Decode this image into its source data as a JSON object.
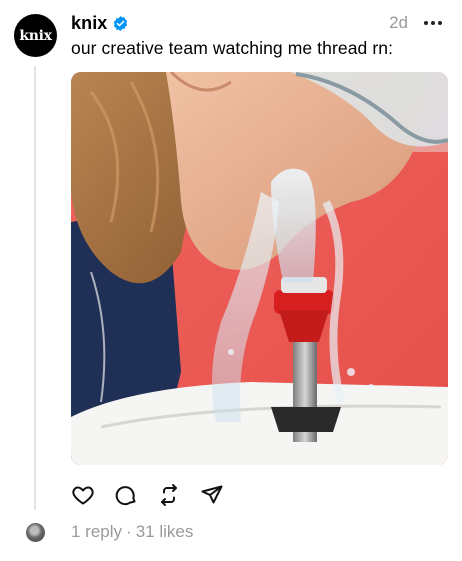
{
  "post": {
    "author": {
      "avatar_text": "knix",
      "username": "knix",
      "verified": true
    },
    "time": "2d",
    "text": "our creative team watching me thread rn:",
    "media": {
      "description": "person with safety goggles rinsing face at an eyewash station"
    },
    "actions": [
      {
        "name": "like",
        "icon": "heart-icon"
      },
      {
        "name": "reply",
        "icon": "comment-icon"
      },
      {
        "name": "repost",
        "icon": "repost-icon"
      },
      {
        "name": "share",
        "icon": "send-icon"
      }
    ],
    "stats": {
      "replies": "1 reply",
      "separator": "·",
      "likes": "31 likes"
    }
  },
  "colors": {
    "verified": "#0095f6",
    "muted": "#9a9a9a",
    "thread_line": "#e3e3e3"
  }
}
